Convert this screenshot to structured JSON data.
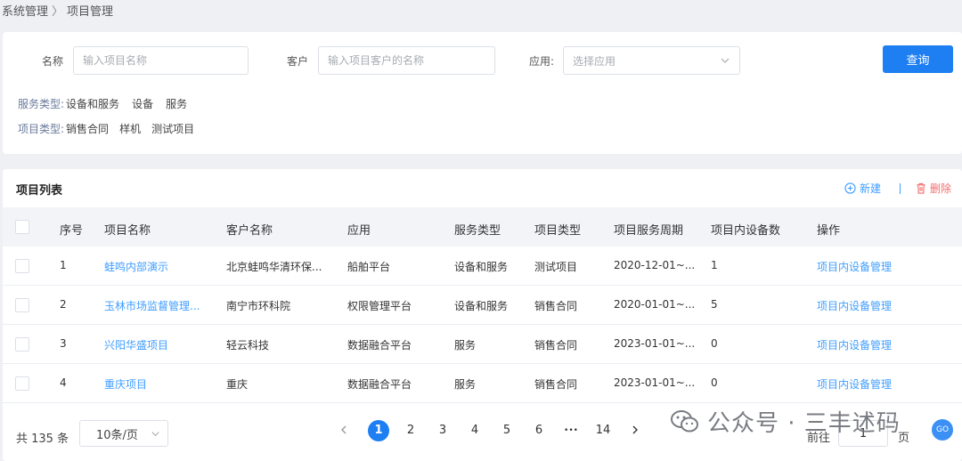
{
  "breadcrumb": {
    "root": "系统管理",
    "separator": "〉",
    "current": "项目管理"
  },
  "filters": {
    "name_label": "名称",
    "name_placeholder": "输入项目名称",
    "customer_label": "客户",
    "customer_placeholder": "输入项目客户的名称",
    "app_label": "应用:",
    "app_placeholder": "选择应用",
    "query_label": "查询",
    "service_type_label": "服务类型:",
    "service_type_options": [
      "设备和服务",
      "设备",
      "服务"
    ],
    "project_type_label": "项目类型:",
    "project_type_options": [
      "销售合同",
      "样机",
      "测试项目"
    ]
  },
  "list": {
    "title": "项目列表",
    "new_label": "新建",
    "delete_label": "删除",
    "columns": [
      "序号",
      "项目名称",
      "客户名称",
      "应用",
      "服务类型",
      "项目类型",
      "项目服务周期",
      "项目内设备数",
      "操作"
    ],
    "rows": [
      {
        "no": "1",
        "name": "蛙鸣内部演示",
        "customer": "北京蛙鸣华清环保...",
        "app": "船舶平台",
        "service": "设备和服务",
        "type": "测试项目",
        "period": "2020-12-01~...",
        "devices": "1",
        "action": "项目内设备管理"
      },
      {
        "no": "2",
        "name": "玉林市场监督管理...",
        "customer": "南宁市环科院",
        "app": "权限管理平台",
        "service": "设备和服务",
        "type": "销售合同",
        "period": "2020-01-01~...",
        "devices": "5",
        "action": "项目内设备管理"
      },
      {
        "no": "3",
        "name": "兴阳华盛项目",
        "customer": "轻云科技",
        "app": "数据融合平台",
        "service": "服务",
        "type": "销售合同",
        "period": "2023-01-01~...",
        "devices": "0",
        "action": "项目内设备管理"
      },
      {
        "no": "4",
        "name": "重庆项目",
        "customer": "重庆",
        "app": "数据融合平台",
        "service": "服务",
        "type": "销售合同",
        "period": "2023-01-01~...",
        "devices": "0",
        "action": "项目内设备管理"
      }
    ]
  },
  "pagination": {
    "total": "共 135 条",
    "page_size": "10条/页",
    "pages": [
      "1",
      "2",
      "3",
      "4",
      "5",
      "6"
    ],
    "ellipsis": "•••",
    "last_page": "14",
    "current_page": "1",
    "goto_prefix": "前往",
    "goto_value": "1",
    "goto_suffix": "页",
    "go_label": "GO"
  },
  "watermark": {
    "text": "公众号 · 三丰述码"
  },
  "colors": {
    "primary": "#1e7ff2",
    "link": "#409eff",
    "danger": "#f56c6c"
  }
}
